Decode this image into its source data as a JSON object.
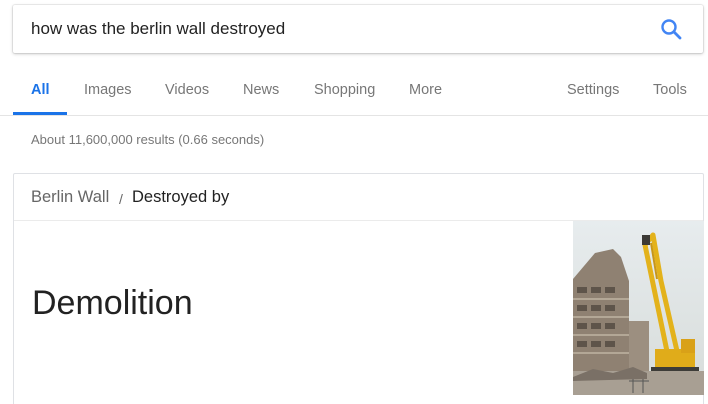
{
  "search": {
    "query": "how was the berlin wall destroyed",
    "icon": "search-icon",
    "accent_color": "#4285f4"
  },
  "tabs": {
    "items": [
      {
        "label": "All",
        "active": true
      },
      {
        "label": "Images"
      },
      {
        "label": "Videos"
      },
      {
        "label": "News"
      },
      {
        "label": "Shopping"
      },
      {
        "label": "More"
      }
    ],
    "settings_label": "Settings",
    "tools_label": "Tools",
    "active_color": "#1a73e8"
  },
  "results_stats": "About 11,600,000 results (0.66 seconds)",
  "knowledge_card": {
    "breadcrumb_entity": "Berlin Wall",
    "breadcrumb_separator": "/",
    "breadcrumb_attribute": "Destroyed by",
    "answer": "Demolition",
    "image_subject": "demolition-excavator-photo"
  }
}
